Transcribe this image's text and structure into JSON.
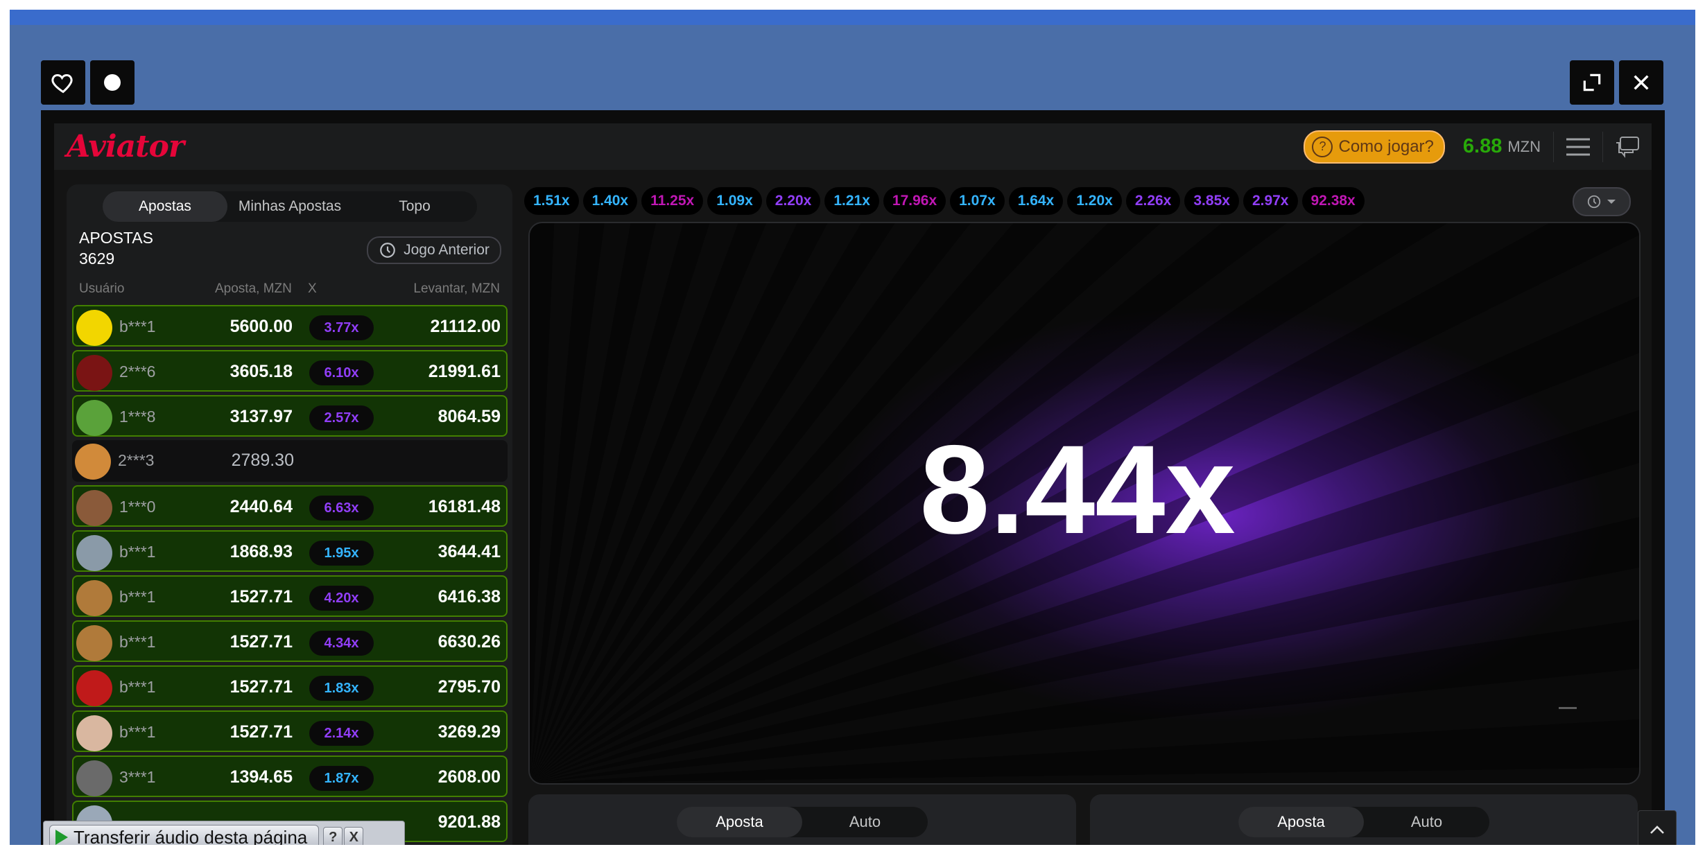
{
  "window": {
    "favorite_icon": "heart-icon",
    "theme_icon": "circle-icon",
    "expand_icon": "expand-icon",
    "close_icon": "close-icon"
  },
  "header": {
    "logo": "Aviator",
    "how_to_play": "Como jogar?",
    "balance": "6.88",
    "currency": "MZN",
    "menu_icon": "hamburger-icon",
    "chat_icon": "chat-icon"
  },
  "bets_panel": {
    "tabs": [
      "Apostas",
      "Minhas Apostas",
      "Topo"
    ],
    "active_tab": "Apostas",
    "title": "APOSTAS",
    "count": "3629",
    "prev_game": "Jogo Anterior",
    "columns": {
      "user": "Usuário",
      "bet": "Aposta, MZN",
      "mult": "X",
      "cashout": "Levantar, MZN"
    },
    "rows": [
      {
        "user": "b***1",
        "bet": "5600.00",
        "mult": "3.77x",
        "cashout": "21112.00",
        "won": true,
        "tone": "purple",
        "avatar": "#f2d600"
      },
      {
        "user": "2***6",
        "bet": "3605.18",
        "mult": "6.10x",
        "cashout": "21991.61",
        "won": true,
        "tone": "purple",
        "avatar": "#7a1414"
      },
      {
        "user": "1***8",
        "bet": "3137.97",
        "mult": "2.57x",
        "cashout": "8064.59",
        "won": true,
        "tone": "purple",
        "avatar": "#5aa23a"
      },
      {
        "user": "2***3",
        "bet": "2789.30",
        "mult": "",
        "cashout": "",
        "won": false,
        "tone": "purple",
        "avatar": "#d18a3a"
      },
      {
        "user": "1***0",
        "bet": "2440.64",
        "mult": "6.63x",
        "cashout": "16181.48",
        "won": true,
        "tone": "purple",
        "avatar": "#8a5a3a"
      },
      {
        "user": "b***1",
        "bet": "1868.93",
        "mult": "1.95x",
        "cashout": "3644.41",
        "won": true,
        "tone": "blue",
        "avatar": "#8a9aa8"
      },
      {
        "user": "b***1",
        "bet": "1527.71",
        "mult": "4.20x",
        "cashout": "6416.38",
        "won": true,
        "tone": "purple",
        "avatar": "#b07a3a"
      },
      {
        "user": "b***1",
        "bet": "1527.71",
        "mult": "4.34x",
        "cashout": "6630.26",
        "won": true,
        "tone": "purple",
        "avatar": "#b07a3a"
      },
      {
        "user": "b***1",
        "bet": "1527.71",
        "mult": "1.83x",
        "cashout": "2795.70",
        "won": true,
        "tone": "blue",
        "avatar": "#c01a1a"
      },
      {
        "user": "b***1",
        "bet": "1527.71",
        "mult": "2.14x",
        "cashout": "3269.29",
        "won": true,
        "tone": "purple",
        "avatar": "#d9b7a0"
      },
      {
        "user": "3***1",
        "bet": "1394.65",
        "mult": "1.87x",
        "cashout": "2608.00",
        "won": true,
        "tone": "blue",
        "avatar": "#6a6a6a"
      },
      {
        "user": "",
        "bet": "",
        "mult": "",
        "cashout": "9201.88",
        "won": true,
        "tone": "blue",
        "avatar": "#9aa8b8"
      }
    ]
  },
  "history": [
    {
      "value": "1.51x",
      "color": "#34b4ff"
    },
    {
      "value": "1.40x",
      "color": "#34b4ff"
    },
    {
      "value": "11.25x",
      "color": "#c017b4"
    },
    {
      "value": "1.09x",
      "color": "#34b4ff"
    },
    {
      "value": "2.20x",
      "color": "#913ef8"
    },
    {
      "value": "1.21x",
      "color": "#34b4ff"
    },
    {
      "value": "17.96x",
      "color": "#c017b4"
    },
    {
      "value": "1.07x",
      "color": "#34b4ff"
    },
    {
      "value": "1.64x",
      "color": "#34b4ff"
    },
    {
      "value": "1.20x",
      "color": "#34b4ff"
    },
    {
      "value": "2.26x",
      "color": "#913ef8"
    },
    {
      "value": "3.85x",
      "color": "#913ef8"
    },
    {
      "value": "2.97x",
      "color": "#913ef8"
    },
    {
      "value": "92.38x",
      "color": "#c017b4"
    }
  ],
  "history_button_icon": "history-icon",
  "stage": {
    "multiplier": "8.44x"
  },
  "bet_controls": [
    {
      "tabs": [
        "Aposta",
        "Auto"
      ],
      "active": "Aposta"
    },
    {
      "tabs": [
        "Aposta",
        "Auto"
      ],
      "active": "Aposta"
    }
  ],
  "audio_toolbar": {
    "label": "Transferir áudio desta página",
    "help": "?",
    "close": "X"
  }
}
